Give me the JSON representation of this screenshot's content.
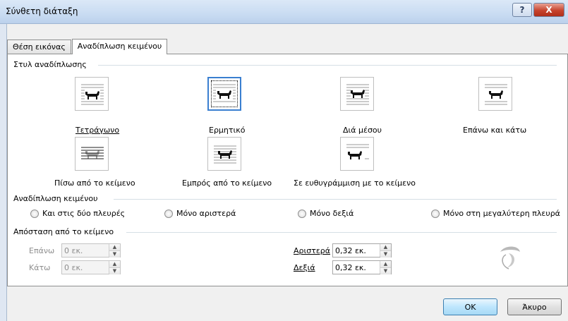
{
  "window": {
    "title": "Σύνθετη διάταξη",
    "help_label": "?",
    "close_label": "X"
  },
  "tabs": [
    {
      "label": "Θέση εικόνας"
    },
    {
      "label": "Αναδίπλωση κειμένου"
    }
  ],
  "wrap_style": {
    "group_label": "Στυλ αναδίπλωσης",
    "options": [
      {
        "label": "Τετράγωνο",
        "icon": "wrap-square-icon"
      },
      {
        "label": "Ερμητικό",
        "icon": "wrap-tight-icon",
        "selected": true
      },
      {
        "label": "Διά μέσου",
        "icon": "wrap-through-icon"
      },
      {
        "label": "Επάνω και κάτω",
        "icon": "wrap-top-bottom-icon"
      },
      {
        "label": "Πίσω από το κείμενο",
        "icon": "wrap-behind-icon"
      },
      {
        "label": "Εμπρός από το κείμενο",
        "icon": "wrap-front-icon"
      },
      {
        "label": "Σε ευθυγράμμιση με το κείμενο",
        "icon": "wrap-inline-icon"
      }
    ]
  },
  "wrap_text": {
    "group_label": "Αναδίπλωση κειμένου",
    "options": [
      {
        "label": "Και στις δύο πλευρές"
      },
      {
        "label": "Μόνο αριστερά"
      },
      {
        "label": "Μόνο δεξιά"
      },
      {
        "label": "Μόνο στη μεγαλύτερη πλευρά"
      }
    ]
  },
  "distance": {
    "group_label": "Απόσταση από το κείμενο",
    "top_label": "Επάνω",
    "top_value": "0 εκ.",
    "bottom_label": "Κάτω",
    "bottom_value": "0 εκ.",
    "left_label": "Αριστερά",
    "left_value": "0,32 εκ.",
    "right_label": "Δεξιά",
    "right_value": "0,32 εκ."
  },
  "buttons": {
    "ok": "OK",
    "cancel": "Άκυρο"
  },
  "colors": {
    "accent": "#3a7fd0",
    "close": "#c7442d"
  }
}
